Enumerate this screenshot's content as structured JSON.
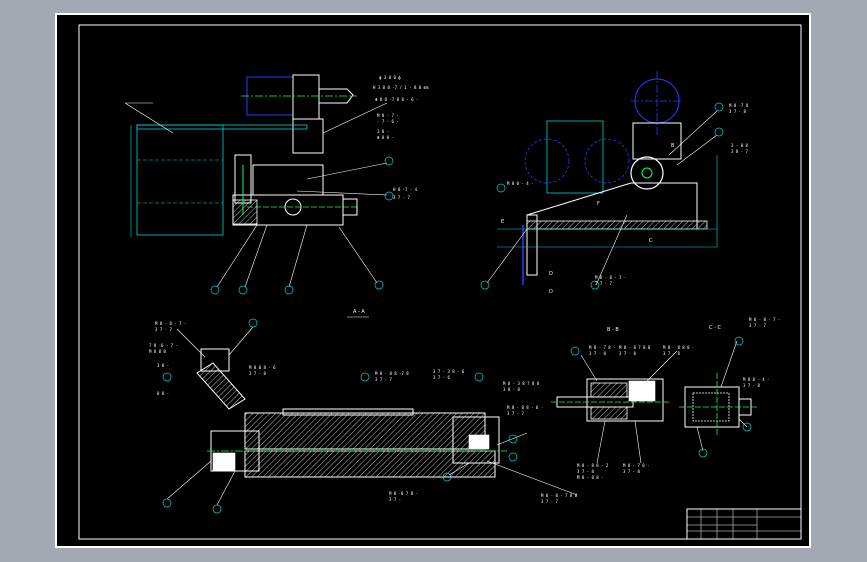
{
  "drawing": {
    "background": "#000000",
    "line_colors": {
      "outline": "#ffffff",
      "dimension": "#00d4d4",
      "center": "#1f3fff",
      "accent": "#00ff66",
      "hatch": "#bbbbbb"
    },
    "views": {
      "view_a": {
        "note_lines": [
          "ф 3 8 0 ф",
          "H 3 8 0 -7 / 1 - 8 8 mm",
          "Φ 8 0 -7 8 8 - 6 -",
          "M 8 - 7 -",
          "- 7 - 6 -",
          "3 8 -",
          "Φ 8 0 -",
          "H 8 -7 - 4",
          "3 7 - 7"
        ]
      },
      "view_b": {
        "letters": [
          "E",
          "F",
          "C",
          "D",
          "D",
          "B"
        ],
        "note_lines": [
          "M 8 -7 8",
          "3 7 - 8",
          "3 - 8 8",
          "3 8 - 7",
          "M 8 0 - 4 -",
          "M 8 - 8 - 7 -",
          "3 7 - 7"
        ]
      },
      "section_aa": {
        "title": "A - A",
        "note_lines": [
          "M 8 - 8 - 7 -",
          "3 7 - 7",
          "7 8 -6 - 7 -",
          "M 8 8 0",
          "3 8 -",
          "8 8 -",
          "M 8 0 8 - 6",
          "3 7 - 8",
          "M 8 - 8 8 -7 8",
          "3 7 - 7",
          "3 7 - 3 8 - 6",
          "3 7 - 6",
          "M 8 - 3 8 7 8 8",
          "3 8 - 8",
          "M 8 - 8 8 - 6 -",
          "3 7 - 7",
          "M 8 -8 7 8 -",
          "3 7 -",
          "M 8 - 8 - 7 8 8",
          "3 7 - 7"
        ]
      },
      "section_bb": {
        "title": "B - B",
        "note_lines": [
          "M 8 - 7 8 -",
          "3 7 - 8",
          "M 8 - 8 7 8 8",
          "3 7 - 8",
          "M 8 - 8 8 8 -",
          "3 7 - 8",
          "M 8 - 8 8 - 2",
          "3 7 - 8",
          "M 8 - 7 8 -",
          "3 7 - 8",
          "M 8 - 8 8 -"
        ]
      },
      "section_cc": {
        "title": "C - C",
        "note_lines": [
          "M 8 - 8 - 7 -",
          "3 7 - 7",
          "M 8 0 - 4 -",
          "3 7 - 8"
        ]
      }
    },
    "title_block": {
      "name": ""
    }
  }
}
